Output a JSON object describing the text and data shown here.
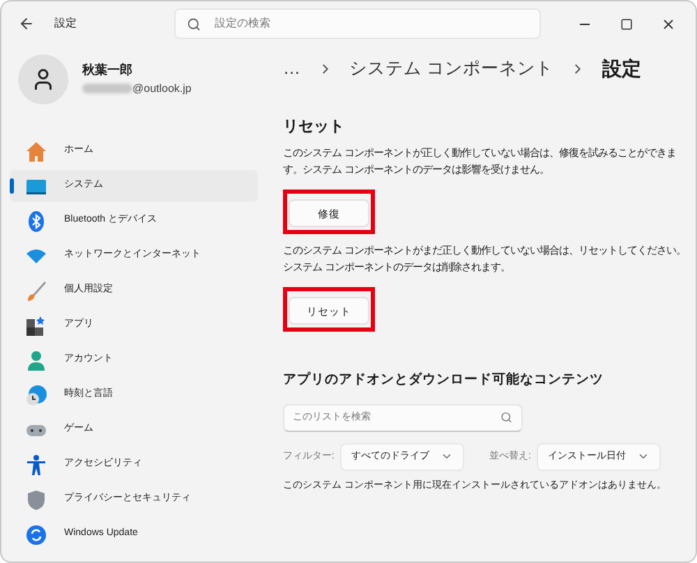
{
  "window": {
    "title": "設定",
    "search_placeholder": "設定の検索"
  },
  "profile": {
    "name": "秋葉一郎",
    "email": "@outlook.jp"
  },
  "breadcrumb": [
    "…",
    "システム コンポーネント",
    "設定"
  ],
  "nav": [
    {
      "label": "ホーム",
      "kind": "home",
      "selected": false
    },
    {
      "label": "システム",
      "kind": "system",
      "selected": true
    },
    {
      "label": "Bluetooth とデバイス",
      "kind": "bluetooth",
      "selected": false
    },
    {
      "label": "ネットワークとインターネット",
      "kind": "network",
      "selected": false
    },
    {
      "label": "個人用設定",
      "kind": "brush",
      "selected": false
    },
    {
      "label": "アプリ",
      "kind": "apps",
      "selected": false
    },
    {
      "label": "アカウント",
      "kind": "account",
      "selected": false
    },
    {
      "label": "時刻と言語",
      "kind": "time",
      "selected": false
    },
    {
      "label": "ゲーム",
      "kind": "game",
      "selected": false
    },
    {
      "label": "アクセシビリティ",
      "kind": "accessibility",
      "selected": false
    },
    {
      "label": "プライバシーとセキュリティ",
      "kind": "shield",
      "selected": false
    },
    {
      "label": "Windows Update",
      "kind": "update",
      "selected": false
    }
  ],
  "reset": {
    "heading": "リセット",
    "repair_text": "このシステム コンポーネントが正しく動作していない場合は、修復を試みることができます。システム コンポーネントのデータは影響を受けません。",
    "repair_button": {
      "label": "修復",
      "highlighted": true
    },
    "reset_text": "このシステム コンポーネントがまだ正しく動作していない場合は、リセットしてください。システム コンポーネントのデータは削除されます。",
    "reset_button": {
      "label": "リセット",
      "highlighted": true
    }
  },
  "addons": {
    "heading": "アプリのアドオンとダウンロード可能なコンテンツ",
    "search_placeholder": "このリストを検索",
    "filter_label": "フィルター:",
    "filter_value": "すべてのドライブ",
    "sort_label": "並べ替え:",
    "sort_value": "インストール日付",
    "empty_text": "このシステム コンポーネント用に現在インストールされているアドオンはありません。"
  }
}
